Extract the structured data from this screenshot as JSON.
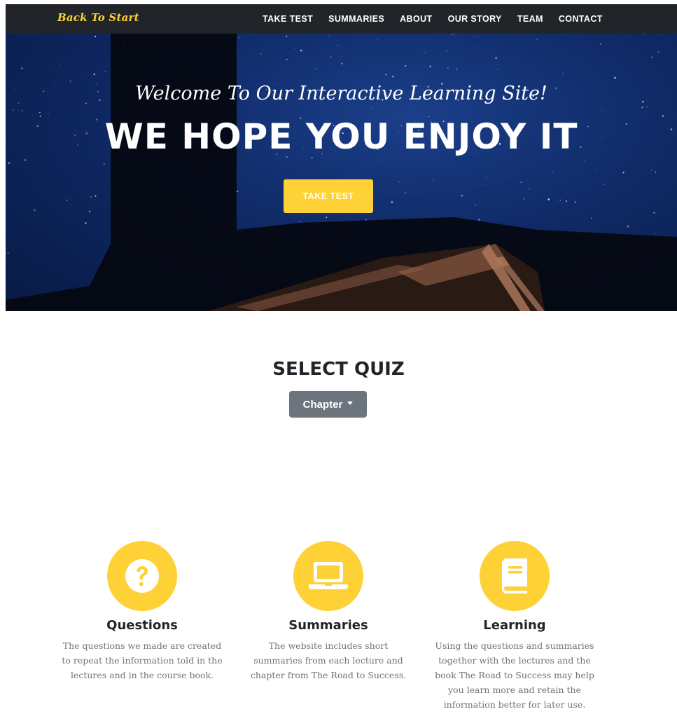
{
  "navbar": {
    "brand": "Back To Start",
    "links": [
      "TAKE TEST",
      "SUMMARIES",
      "ABOUT",
      "OUR STORY",
      "TEAM",
      "CONTACT"
    ]
  },
  "hero": {
    "subtitle": "Welcome To Our Interactive Learning Site!",
    "title": "WE HOPE YOU ENJOY IT",
    "button_label": "TAKE TEST"
  },
  "quiz": {
    "heading": "SELECT QUIZ",
    "dropdown_label": "Chapter"
  },
  "features": [
    {
      "icon": "question-circle-icon",
      "title": "Questions",
      "text": "The questions we made are created to repeat the information told in the lectures and in the course book."
    },
    {
      "icon": "laptop-icon",
      "title": "Summaries",
      "text": "The website includes short summaries from each lecture and chapter from The Road to Success."
    },
    {
      "icon": "book-icon",
      "title": "Learning",
      "text": "Using the questions and summaries together with the lectures and the book The Road to Success may help you learn more and retain the information better for later use."
    }
  ],
  "colors": {
    "accent": "#fed136",
    "navbar_bg": "#212529",
    "dropdown_bg": "#6c757d",
    "text_muted": "#6c757d"
  }
}
